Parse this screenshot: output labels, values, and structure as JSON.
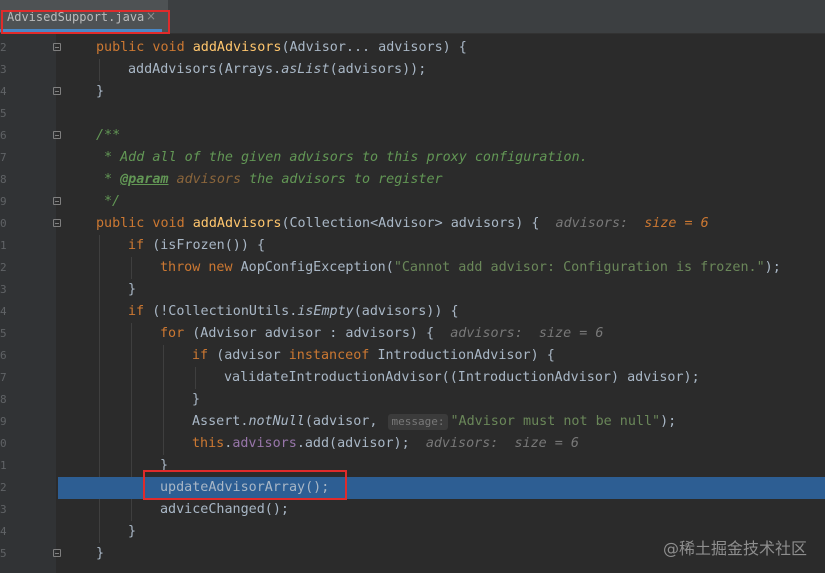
{
  "tab": {
    "filename": "AdvisedSupport.java",
    "close_glyph": "×"
  },
  "gutter": {
    "line_numbers": [
      "2",
      "3",
      "4",
      "5",
      "6",
      "7",
      "8",
      "9",
      "0",
      "1",
      "2",
      "3",
      "4",
      "5",
      "6",
      "7",
      "8",
      "9",
      "0",
      "1",
      "2",
      "3",
      "4",
      "5"
    ]
  },
  "code": {
    "l1": {
      "kw1": "public void ",
      "fn": "addAdvisors",
      "rest": "(Advisor... advisors) {"
    },
    "l2": {
      "a": "addAdvisors(Arrays.",
      "b": "asList",
      "c": "(advisors));"
    },
    "l3": {
      "a": "}"
    },
    "l5": {
      "a": "/**"
    },
    "l6": {
      "a": "* Add all of the given advisors to this proxy configuration."
    },
    "l7": {
      "star": "* ",
      "tag": "@param",
      "ref": " advisors",
      "rest": " the advisors to register"
    },
    "l8": {
      "a": "*/"
    },
    "l9": {
      "kw1": "public void ",
      "fn": "addAdvisors",
      "rest": "(Collection<Advisor> advisors) {",
      "hint_name": "advisors:",
      "hint_val": "size = 6"
    },
    "l10": {
      "kw": "if ",
      "rest": "(isFrozen()) {"
    },
    "l11": {
      "kw": "throw new ",
      "a": "AopConfigException(",
      "str": "\"Cannot add advisor: Configuration is frozen.\"",
      "b": ");"
    },
    "l12": {
      "a": "}"
    },
    "l13": {
      "kw": "if ",
      "a": "(!CollectionUtils.",
      "b": "isEmpty",
      "c": "(advisors)) {"
    },
    "l14": {
      "kw": "for ",
      "rest": "(Advisor advisor : advisors) {",
      "hint_name": "advisors:",
      "hint_val": "size = 6"
    },
    "l15": {
      "kw": "if ",
      "a": "(advisor ",
      "kw2": "instanceof ",
      "b": "IntroductionAdvisor) {"
    },
    "l16": {
      "a": "validateIntroductionAdvisor((IntroductionAdvisor) advisor);"
    },
    "l17": {
      "a": "}"
    },
    "l18": {
      "a": "Assert.",
      "b": "notNull",
      "c": "(advisor, ",
      "param": "message:",
      "str": "\"Advisor must not be null\"",
      "d": ");"
    },
    "l19": {
      "kw": "this",
      "a": ".",
      "fld": "advisors",
      "b": ".add(advisor);",
      "hint_name": "advisors:",
      "hint_val": "size = 6"
    },
    "l20": {
      "a": "}"
    },
    "l21": {
      "a": "updateAdvisorArray();"
    },
    "l22": {
      "a": "adviceChanged();"
    },
    "l23": {
      "a": "}"
    },
    "l24": {
      "a": "}"
    }
  },
  "watermark": "@稀土掘金技术社区",
  "colors": {
    "background": "#2b2b2b",
    "current_line": "#2d5e93",
    "annotation_box": "#e02b2b",
    "keyword": "#cc7832",
    "method": "#ffc66d"
  }
}
